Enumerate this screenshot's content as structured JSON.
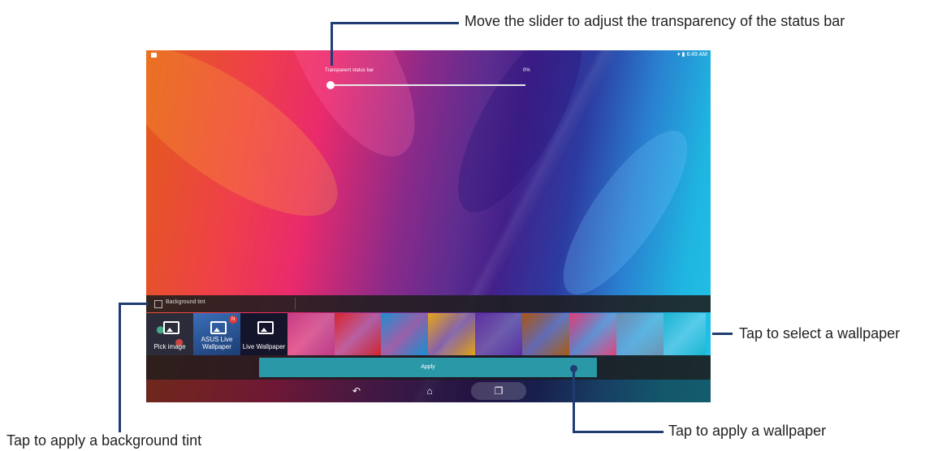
{
  "status_bar": {
    "time": "6:49 AM",
    "icons": [
      "notification-icon",
      "wifi-icon",
      "battery-icon"
    ]
  },
  "slider": {
    "label": "Transparent status bar",
    "value_text": "0%",
    "value_fraction": 0.0
  },
  "tint": {
    "label": "Background tint",
    "checked": false
  },
  "wallpapers": {
    "pick_image": {
      "label": "Pick image",
      "icon": "image-icon"
    },
    "asus_live": {
      "label": "ASUS Live Wallpaper",
      "badge": "N",
      "icon": "image-icon"
    },
    "live": {
      "label": "Live Wallpaper",
      "icon": "image-icon"
    },
    "swatch_colors": [
      "#c23a86",
      "#d3242e",
      "#1b8ed1",
      "#e6a514",
      "#5a2ea3",
      "#a8580f",
      "#e0407a",
      "#6c8fb2",
      "#19b6d2"
    ]
  },
  "apply_button": {
    "label": "Apply"
  },
  "nav": {
    "icons": [
      "back-icon",
      "home-icon",
      "recent-apps-icon"
    ]
  },
  "callouts": {
    "slider": "Move the slider to adjust the transparency of the status bar",
    "wallpaper": "Tap to select a wallpaper",
    "apply": "Tap to apply a wallpaper",
    "tint": "Tap to apply a background tint"
  },
  "colors": {
    "callout_line": "#1f3c73",
    "apply_button": "#2a98a6"
  }
}
